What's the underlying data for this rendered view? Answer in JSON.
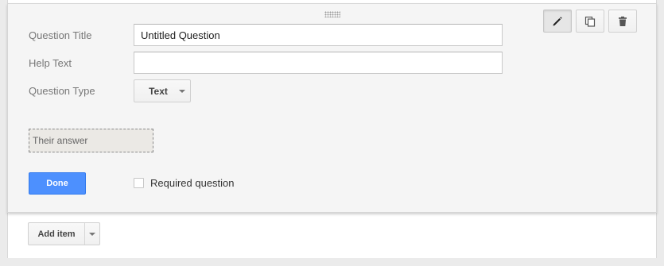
{
  "editor": {
    "question_title_label": "Question Title",
    "question_title_value": "Untitled Question",
    "help_text_label": "Help Text",
    "help_text_value": "",
    "question_type_label": "Question Type",
    "question_type_value": "Text",
    "answer_preview": "Their answer",
    "done_label": "Done",
    "required_label": "Required question",
    "required_checked": false
  },
  "toolbar": {
    "edit_icon": "pencil-icon",
    "duplicate_icon": "duplicate-icon",
    "delete_icon": "trash-icon"
  },
  "footer": {
    "add_item_label": "Add item"
  },
  "colors": {
    "primary_button": "#4d90fe",
    "panel_background": "#f5f5f5",
    "page_background": "#ebebeb"
  }
}
